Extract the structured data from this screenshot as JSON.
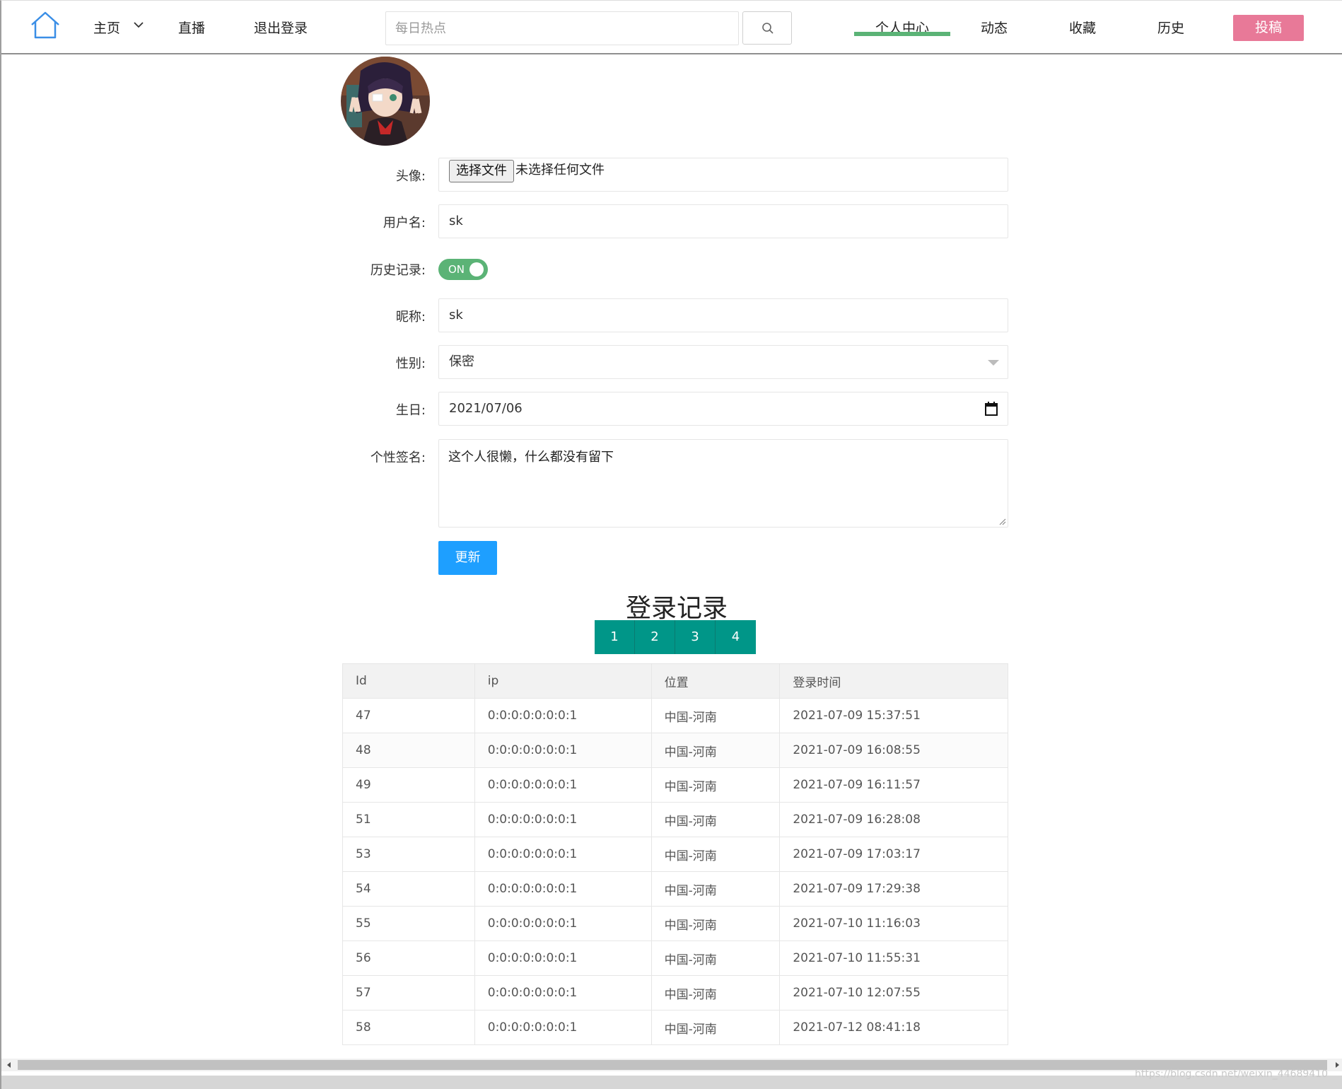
{
  "nav": {
    "home": "主页",
    "live": "直播",
    "logout": "退出登录",
    "search_placeholder": "每日热点",
    "personal_center": "个人中心",
    "dynamics": "动态",
    "favorites": "收藏",
    "history": "历史",
    "post": "投稿"
  },
  "form": {
    "avatar_label": "头像:",
    "file_button": "选择文件",
    "file_status": "未选择任何文件",
    "username_label": "用户名:",
    "username_value": "sk",
    "history_label": "历史记录:",
    "history_toggle": "ON",
    "nickname_label": "昵称:",
    "nickname_value": "sk",
    "gender_label": "性别:",
    "gender_value": "保密",
    "birthday_label": "生日:",
    "birthday_value": "2021/07/06",
    "signature_label": "个性签名:",
    "signature_value": "这个人很懒，什么都没有留下",
    "update_button": "更新"
  },
  "records": {
    "title": "登录记录",
    "pages": [
      "1",
      "2",
      "3",
      "4"
    ],
    "columns": [
      "Id",
      "ip",
      "位置",
      "登录时间"
    ],
    "rows": [
      [
        "47",
        "0:0:0:0:0:0:0:1",
        "中国-河南",
        "2021-07-09 15:37:51"
      ],
      [
        "48",
        "0:0:0:0:0:0:0:1",
        "中国-河南",
        "2021-07-09 16:08:55"
      ],
      [
        "49",
        "0:0:0:0:0:0:0:1",
        "中国-河南",
        "2021-07-09 16:11:57"
      ],
      [
        "51",
        "0:0:0:0:0:0:0:1",
        "中国-河南",
        "2021-07-09 16:28:08"
      ],
      [
        "53",
        "0:0:0:0:0:0:0:1",
        "中国-河南",
        "2021-07-09 17:03:17"
      ],
      [
        "54",
        "0:0:0:0:0:0:0:1",
        "中国-河南",
        "2021-07-09 17:29:38"
      ],
      [
        "55",
        "0:0:0:0:0:0:0:1",
        "中国-河南",
        "2021-07-10 11:16:03"
      ],
      [
        "56",
        "0:0:0:0:0:0:0:1",
        "中国-河南",
        "2021-07-10 11:55:31"
      ],
      [
        "57",
        "0:0:0:0:0:0:0:1",
        "中国-河南",
        "2021-07-10 12:07:55"
      ],
      [
        "58",
        "0:0:0:0:0:0:0:1",
        "中国-河南",
        "2021-07-12 08:41:18"
      ]
    ]
  },
  "watermark": "https://blog.csdn.net/weixin_44689410",
  "colors": {
    "accent_green": "#5bb376",
    "post_pink": "#e87998",
    "update_blue": "#1e9fff",
    "pager_teal": "#009688"
  }
}
